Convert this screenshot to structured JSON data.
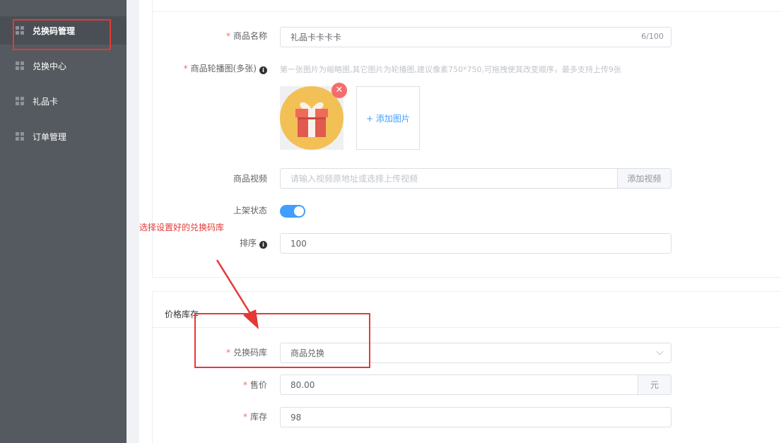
{
  "sidebar": {
    "items": [
      {
        "label": "兑换码管理",
        "active": true
      },
      {
        "label": "兑换中心",
        "active": false
      },
      {
        "label": "礼品卡",
        "active": false
      },
      {
        "label": "订单管理",
        "active": false
      }
    ]
  },
  "form": {
    "name": {
      "label": "商品名称",
      "value": "礼品卡卡卡卡",
      "count": "6/100"
    },
    "carousel": {
      "label": "商品轮播图(多张)",
      "hint": "第一张图片为缩略图,其它图片为轮播图,建议像素750*750,可拖拽使其改变顺序，最多支持上传9张",
      "upload_label": "+ 添加图片"
    },
    "video": {
      "label": "商品视频",
      "placeholder": "请输入视频原地址或选择上传视频",
      "button": "添加视频"
    },
    "status": {
      "label": "上架状态",
      "on": true
    },
    "sort": {
      "label": "排序",
      "value": "100"
    }
  },
  "price_section": {
    "title": "价格库存",
    "code_lib": {
      "label": "兑换码库",
      "value": "商品兑换"
    },
    "price": {
      "label": "售价",
      "value": "80.00",
      "unit": "元"
    },
    "stock": {
      "label": "库存",
      "value": "98"
    }
  },
  "annotation": {
    "text": "选择设置好的兑换码库"
  },
  "colors": {
    "accent": "#409eff",
    "annotation": "#e53935",
    "sidebar": "#555a60"
  }
}
